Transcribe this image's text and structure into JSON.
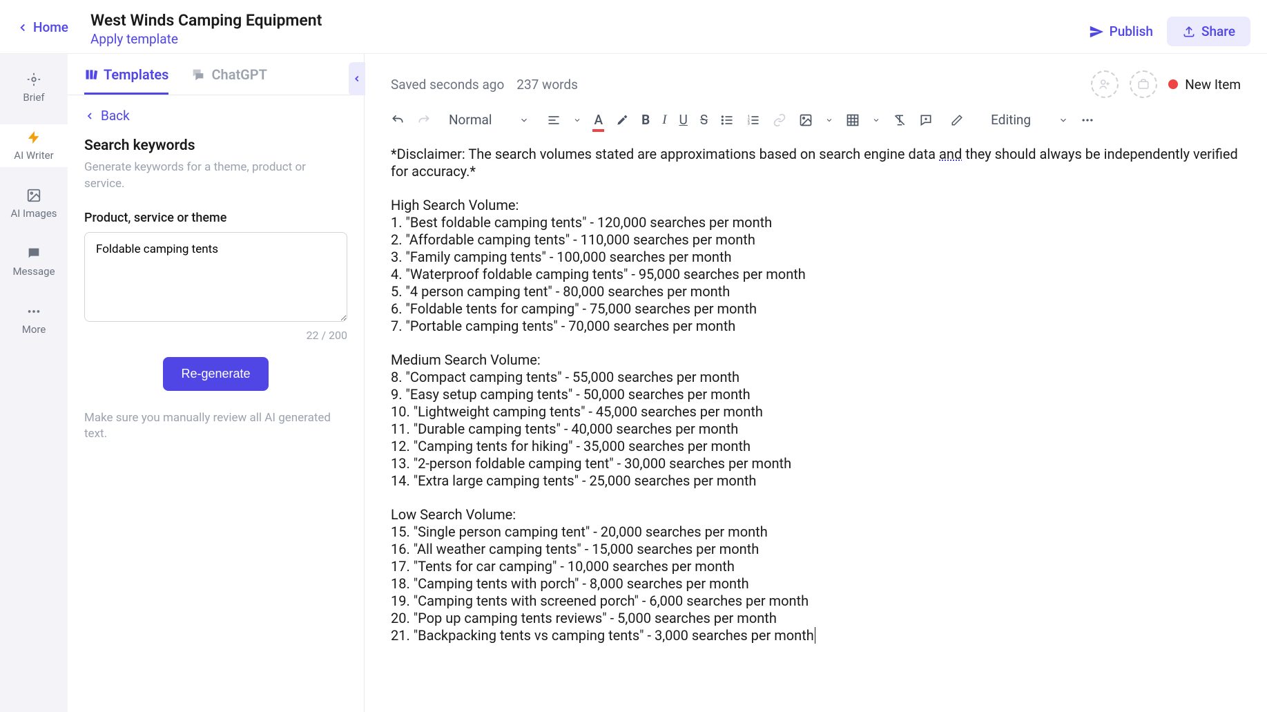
{
  "header": {
    "home": "Home",
    "title": "West Winds Camping Equipment",
    "apply_template": "Apply template",
    "publish": "Publish",
    "share": "Share"
  },
  "left_rail": {
    "items": [
      "Brief",
      "AI Writer",
      "AI Images",
      "Message",
      "More"
    ]
  },
  "panel": {
    "tabs": {
      "templates": "Templates",
      "chatgpt": "ChatGPT"
    },
    "back": "Back",
    "heading": "Search keywords",
    "sub": "Generate keywords for a theme, product or service.",
    "field_label": "Product, service or theme",
    "field_value": "Foldable camping tents",
    "char_count": "22 / 200",
    "regenerate": "Re-generate",
    "review_note": "Make sure you manually review all AI generated text."
  },
  "editor_meta": {
    "saved": "Saved seconds ago",
    "words": "237 words",
    "new_item": "New Item",
    "text_style": "Normal",
    "editing_mode": "Editing"
  },
  "content": {
    "disclaimer_pre": "*Disclaimer: The search volumes stated are approximations based on search engine data ",
    "disclaimer_and": "and",
    "disclaimer_post": " they should always be independently verified for accuracy.*",
    "high_title": "High Search Volume:",
    "high": [
      "1. \"Best foldable camping tents\" - 120,000 searches per month",
      "2. \"Affordable camping tents\" - 110,000 searches per month",
      "3. \"Family camping tents\" - 100,000 searches per month",
      "4. \"Waterproof foldable camping tents\" - 95,000 searches per month",
      "5. \"4 person camping tent\" - 80,000 searches per month",
      "6. \"Foldable tents for camping\" - 75,000 searches per month",
      "7. \"Portable camping tents\" - 70,000 searches per month"
    ],
    "medium_title": "Medium Search Volume:",
    "medium": [
      "8. \"Compact camping tents\" - 55,000 searches per month",
      "9. \"Easy setup camping tents\" - 50,000 searches per month",
      "10. \"Lightweight camping tents\" - 45,000 searches per month",
      "11. \"Durable camping tents\" - 40,000 searches per month",
      "12. \"Camping tents for hiking\" - 35,000 searches per month",
      "13. \"2-person foldable camping tent\" - 30,000 searches per month",
      "14. \"Extra large camping tents\" - 25,000 searches per month"
    ],
    "low_title": "Low Search Volume:",
    "low": [
      "15. \"Single person camping tent\" - 20,000 searches per month",
      "16. \"All weather camping tents\" - 15,000 searches per month",
      "17. \"Tents for car camping\" - 10,000 searches per month",
      "18. \"Camping tents with porch\" - 8,000 searches per month",
      "19. \"Camping tents with screened porch\" - 6,000 searches per month",
      "20. \"Pop up camping tents reviews\" - 5,000 searches per month",
      "21. \"Backpacking tents vs camping tents\" - 3,000 searches per month"
    ]
  }
}
